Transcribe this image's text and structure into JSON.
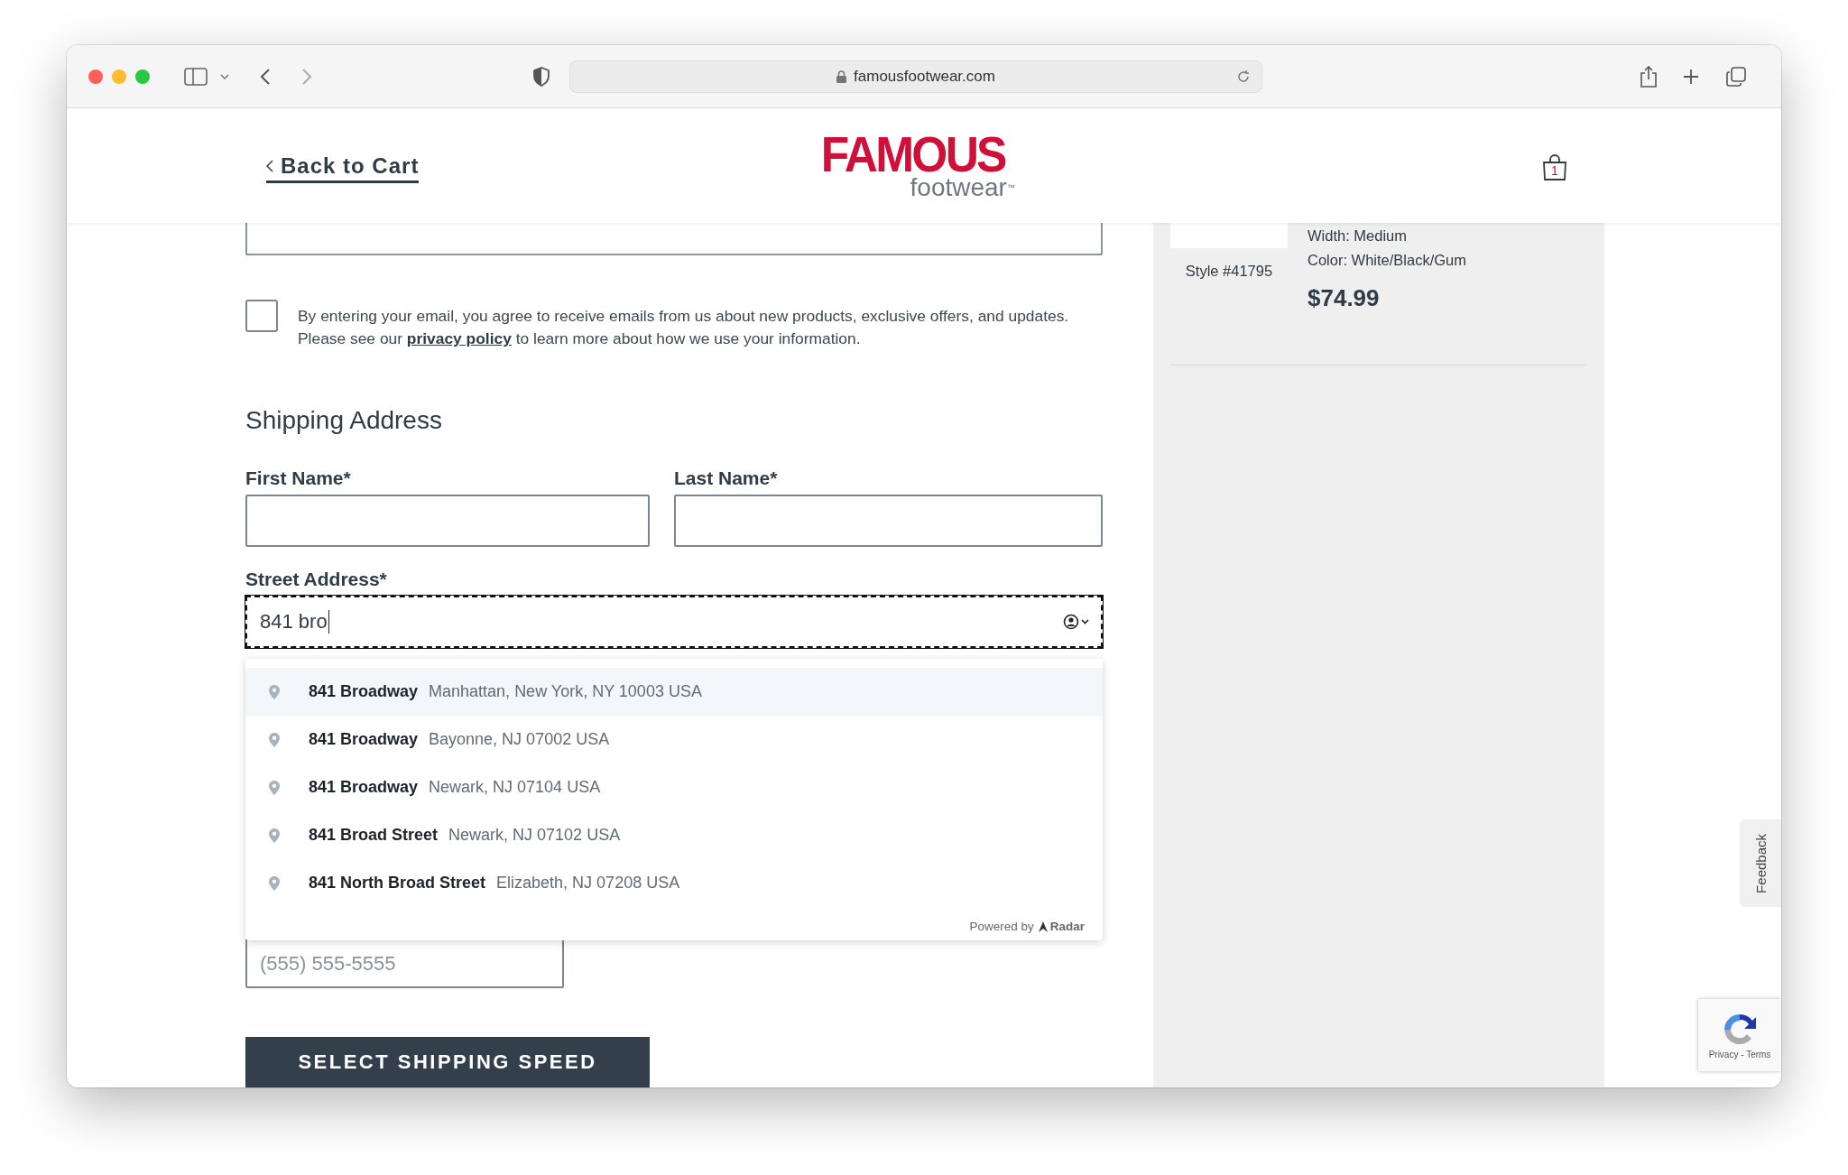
{
  "browser": {
    "url": "famousfootwear.com"
  },
  "header": {
    "back_link": "Back to Cart",
    "logo": {
      "brand": "FAMOUS",
      "sub": "footwear",
      "mark": "™"
    },
    "cart_count": "1"
  },
  "consent": {
    "checked": false,
    "line_1": "By entering your email, you agree to receive emails from us about new products, exclusive offers, and updates.",
    "line_2_before": "Please see our",
    "link": "privacy policy",
    "line_2_after": "to learn more about how we use your information."
  },
  "shipping": {
    "title": "Shipping Address",
    "first_name_label": "First Name*",
    "last_name_label": "Last Name*",
    "street_label": "Street Address*",
    "street_value": "841 bro",
    "phone_placeholder": "(555) 555-5555"
  },
  "suggestions": [
    {
      "street": "841 Broadway",
      "locality": "Manhattan, New York, NY 10003 USA",
      "selected": true
    },
    {
      "street": "841 Broadway",
      "locality": "Bayonne, NJ 07002 USA",
      "selected": false
    },
    {
      "street": "841 Broadway",
      "locality": "Newark, NJ 07104 USA",
      "selected": false
    },
    {
      "street": "841 Broad Street",
      "locality": "Newark, NJ 07102 USA",
      "selected": false
    },
    {
      "street": "841 North Broad Street",
      "locality": "Elizabeth, NJ 07208 USA",
      "selected": false
    }
  ],
  "powered_by": {
    "text": "Powered by",
    "brand": "Radar"
  },
  "submit_button": "SELECT SHIPPING SPEED",
  "order_summary": {
    "style": "Style #41795",
    "width": "Width: Medium",
    "color_line": "Color: White/Black/Gum",
    "price": "$74.99"
  },
  "feedback_tab": "Feedback",
  "recaptcha": {
    "links": "Privacy - Terms"
  }
}
